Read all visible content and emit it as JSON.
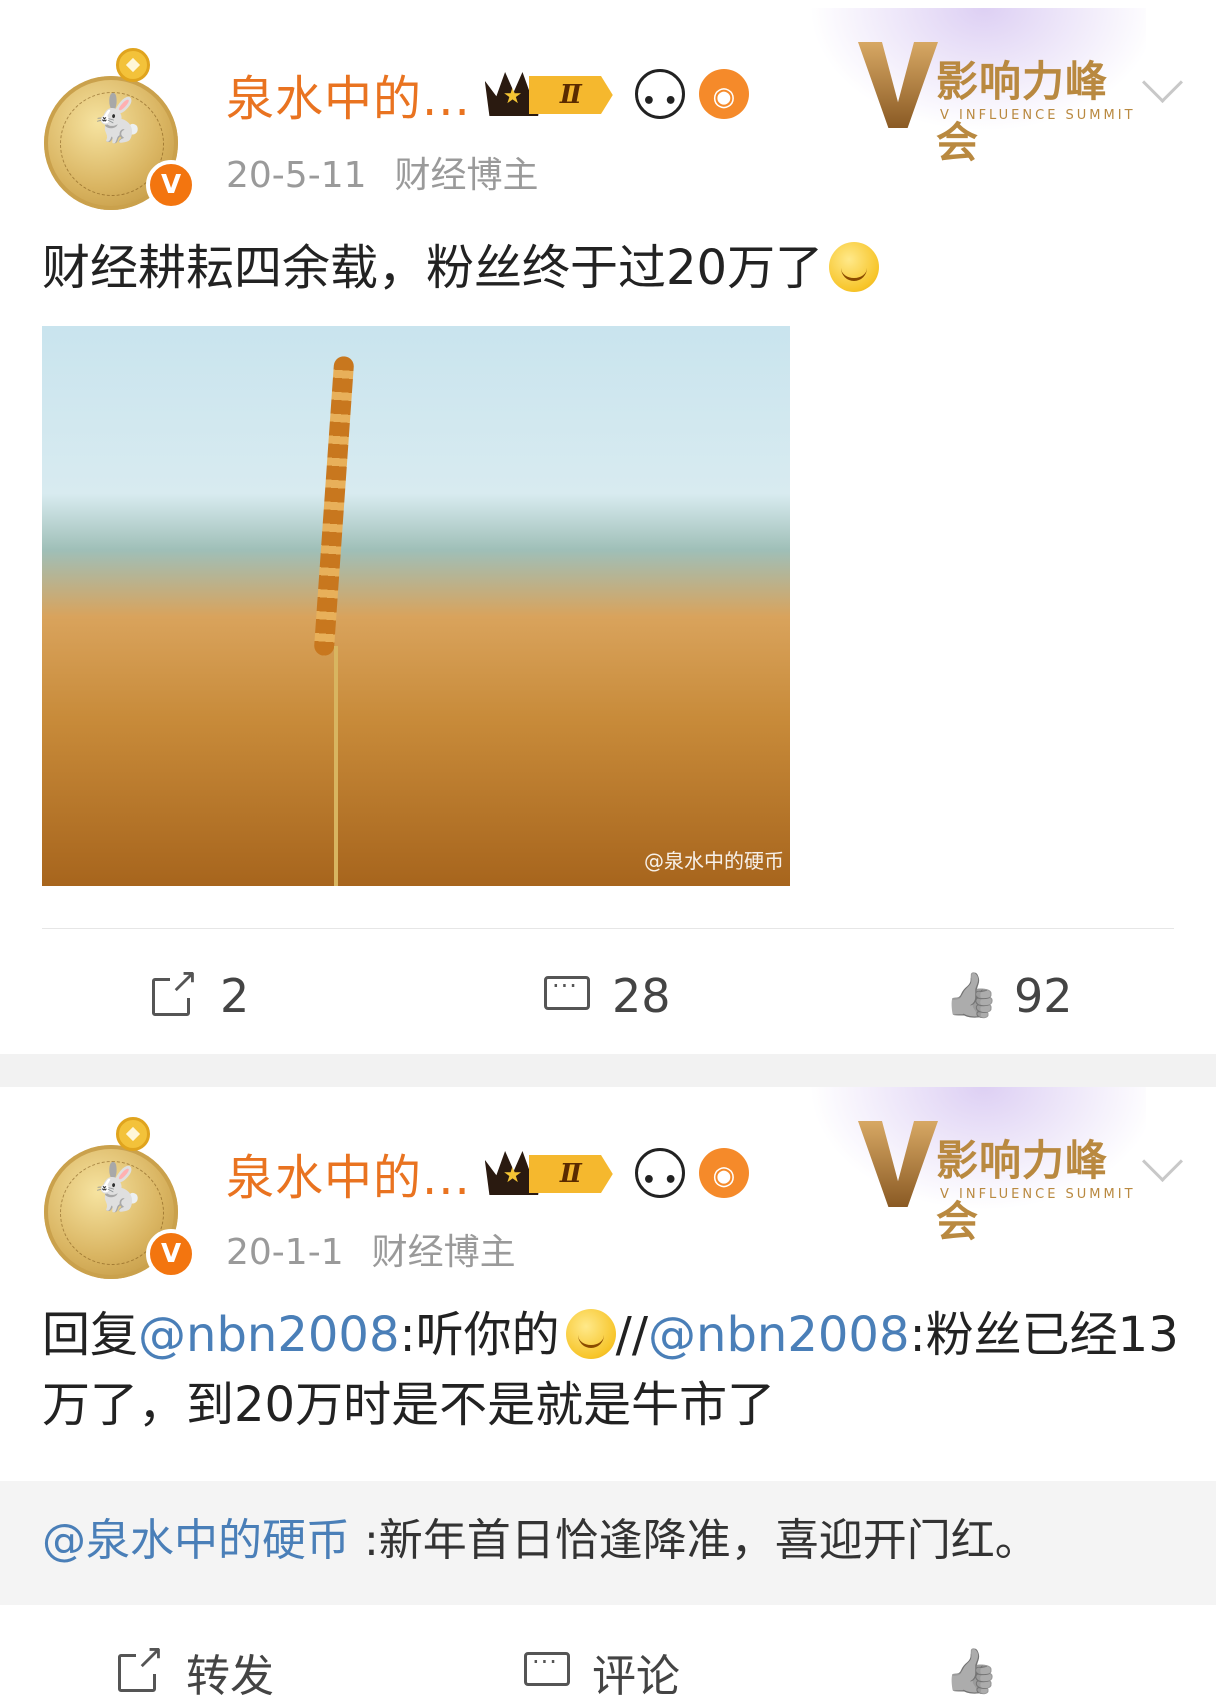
{
  "post1": {
    "username": "泉水中的...",
    "date": "20-5-11",
    "tag": "财经博主",
    "vip_level": "Ⅱ",
    "verified_badge": "V",
    "brand_zh": "影响力峰会",
    "brand_en": "V INFLUENCE SUMMIT",
    "text": "财经耕耘四余载，粉丝终于过20万了",
    "image_watermark": "@泉水中的硬币",
    "actions": {
      "repost": "2",
      "comments": "28",
      "likes": "92"
    }
  },
  "post2": {
    "username": "泉水中的...",
    "date": "20-1-1",
    "tag": "财经博主",
    "vip_level": "Ⅱ",
    "verified_badge": "V",
    "brand_zh": "影响力峰会",
    "brand_en": "V INFLUENCE SUMMIT",
    "reply_prefix": "回复",
    "mention1": "@nbn2008",
    "reply_mid": ":听你的",
    "separator": "//",
    "mention2": "@nbn2008",
    "reply_rest": ":粉丝已经13万了，到20万时是不是就是牛市了",
    "quote_author": "@泉水中的硬币",
    "quote_text": " :新年首日恰逢降准，喜迎开门红。",
    "actions": {
      "repost_label": "转发",
      "comment_label": "评论"
    }
  },
  "colors": {
    "username": "#e97320",
    "mention": "#4a7fb8",
    "verified": "#f3750f",
    "background": "#f2f2f2"
  },
  "icons": [
    "share-icon",
    "comment-icon",
    "like-icon",
    "chevron-down-icon",
    "crown-icon",
    "panda-icon",
    "fish-icon",
    "smile-emoji"
  ]
}
